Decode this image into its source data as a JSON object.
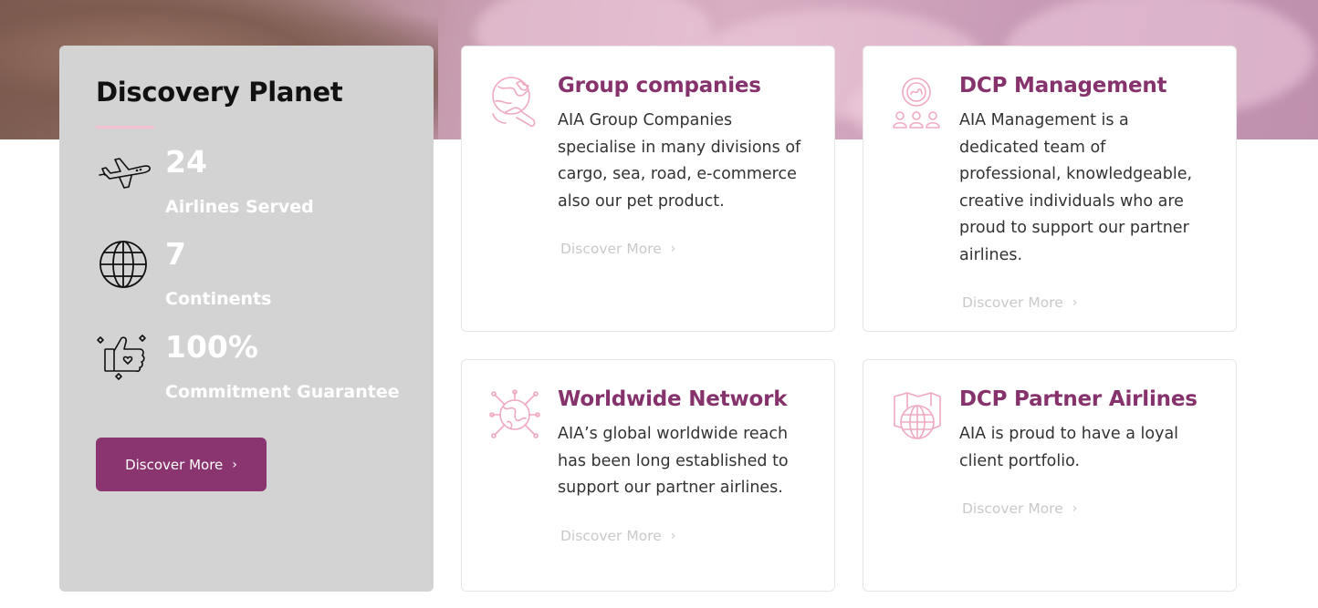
{
  "colors": {
    "accent": "#8b3570",
    "heading": "#86326c",
    "icon_pink": "#f0a8c3"
  },
  "stats": {
    "title": "Discovery Planet",
    "items": [
      {
        "icon": "airplane-icon",
        "number": "24",
        "label": "Airlines Served"
      },
      {
        "icon": "globe-icon",
        "number": "7",
        "label": "Continents"
      },
      {
        "icon": "thumbs-up-icon",
        "number": "100%",
        "label": "Commitment Guarantee"
      }
    ],
    "button_label": "Discover More"
  },
  "services": [
    {
      "icon": "global-search-icon",
      "title": "Group companies",
      "text": "AIA Group Companies specialise in many divisions of cargo, sea, road, e-commerce also our pet product.",
      "link": "Discover More"
    },
    {
      "icon": "team-management-icon",
      "title": "DCP Management",
      "text": "AIA Management is a dedicated team of professional, knowledgeable, creative individuals who are proud to support our partner airlines.",
      "link": "Discover More"
    },
    {
      "icon": "network-globe-icon",
      "title": "Worldwide Network",
      "text": "AIA’s global worldwide reach has been long established to support our partner airlines.",
      "link": "Discover More"
    },
    {
      "icon": "map-globe-icon",
      "title": "DCP Partner Airlines",
      "text": "AIA is proud to have a loyal client portfolio.",
      "link": "Discover More"
    }
  ]
}
